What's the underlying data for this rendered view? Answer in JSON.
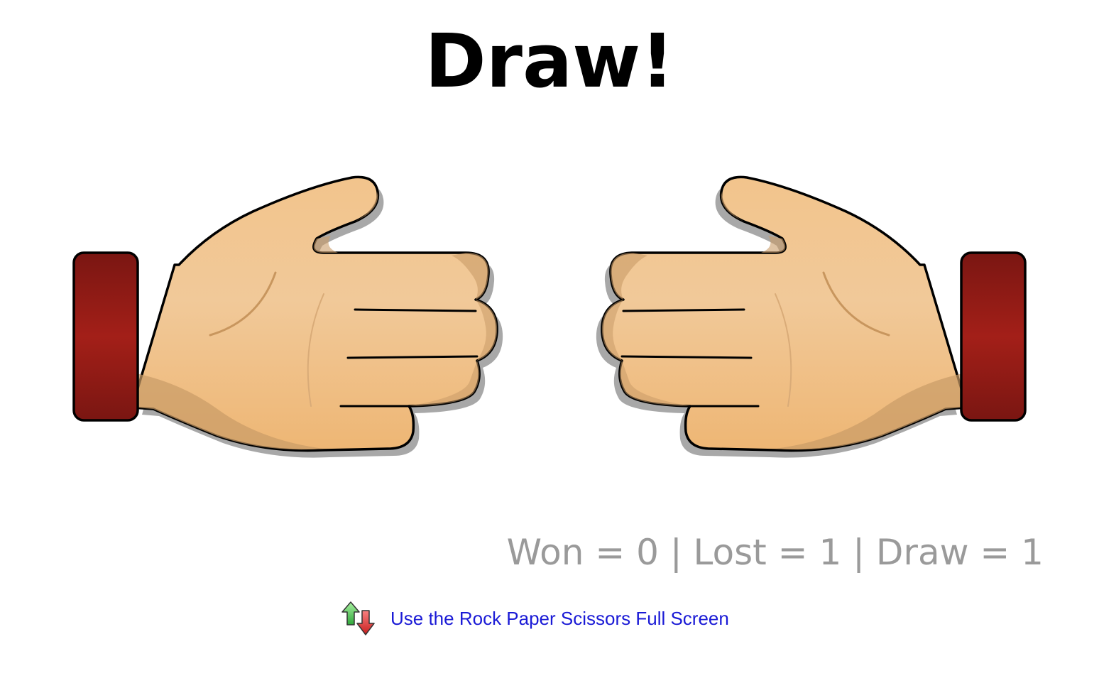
{
  "game": {
    "result_title": "Draw!",
    "player_hand": "rock",
    "computer_hand": "rock"
  },
  "score": {
    "text": "Won = 0 | Lost = 1 | Draw = 1",
    "won": 0,
    "lost": 1,
    "draw": 1
  },
  "fullscreen": {
    "label": "Use the Rock Paper Scissors Full Screen",
    "icon": "up-down-arrows-icon"
  },
  "colors": {
    "skin": "#efc08a",
    "cuff": "#8c1a16",
    "link": "#1a1ad6",
    "score": "#9a9a9a"
  }
}
